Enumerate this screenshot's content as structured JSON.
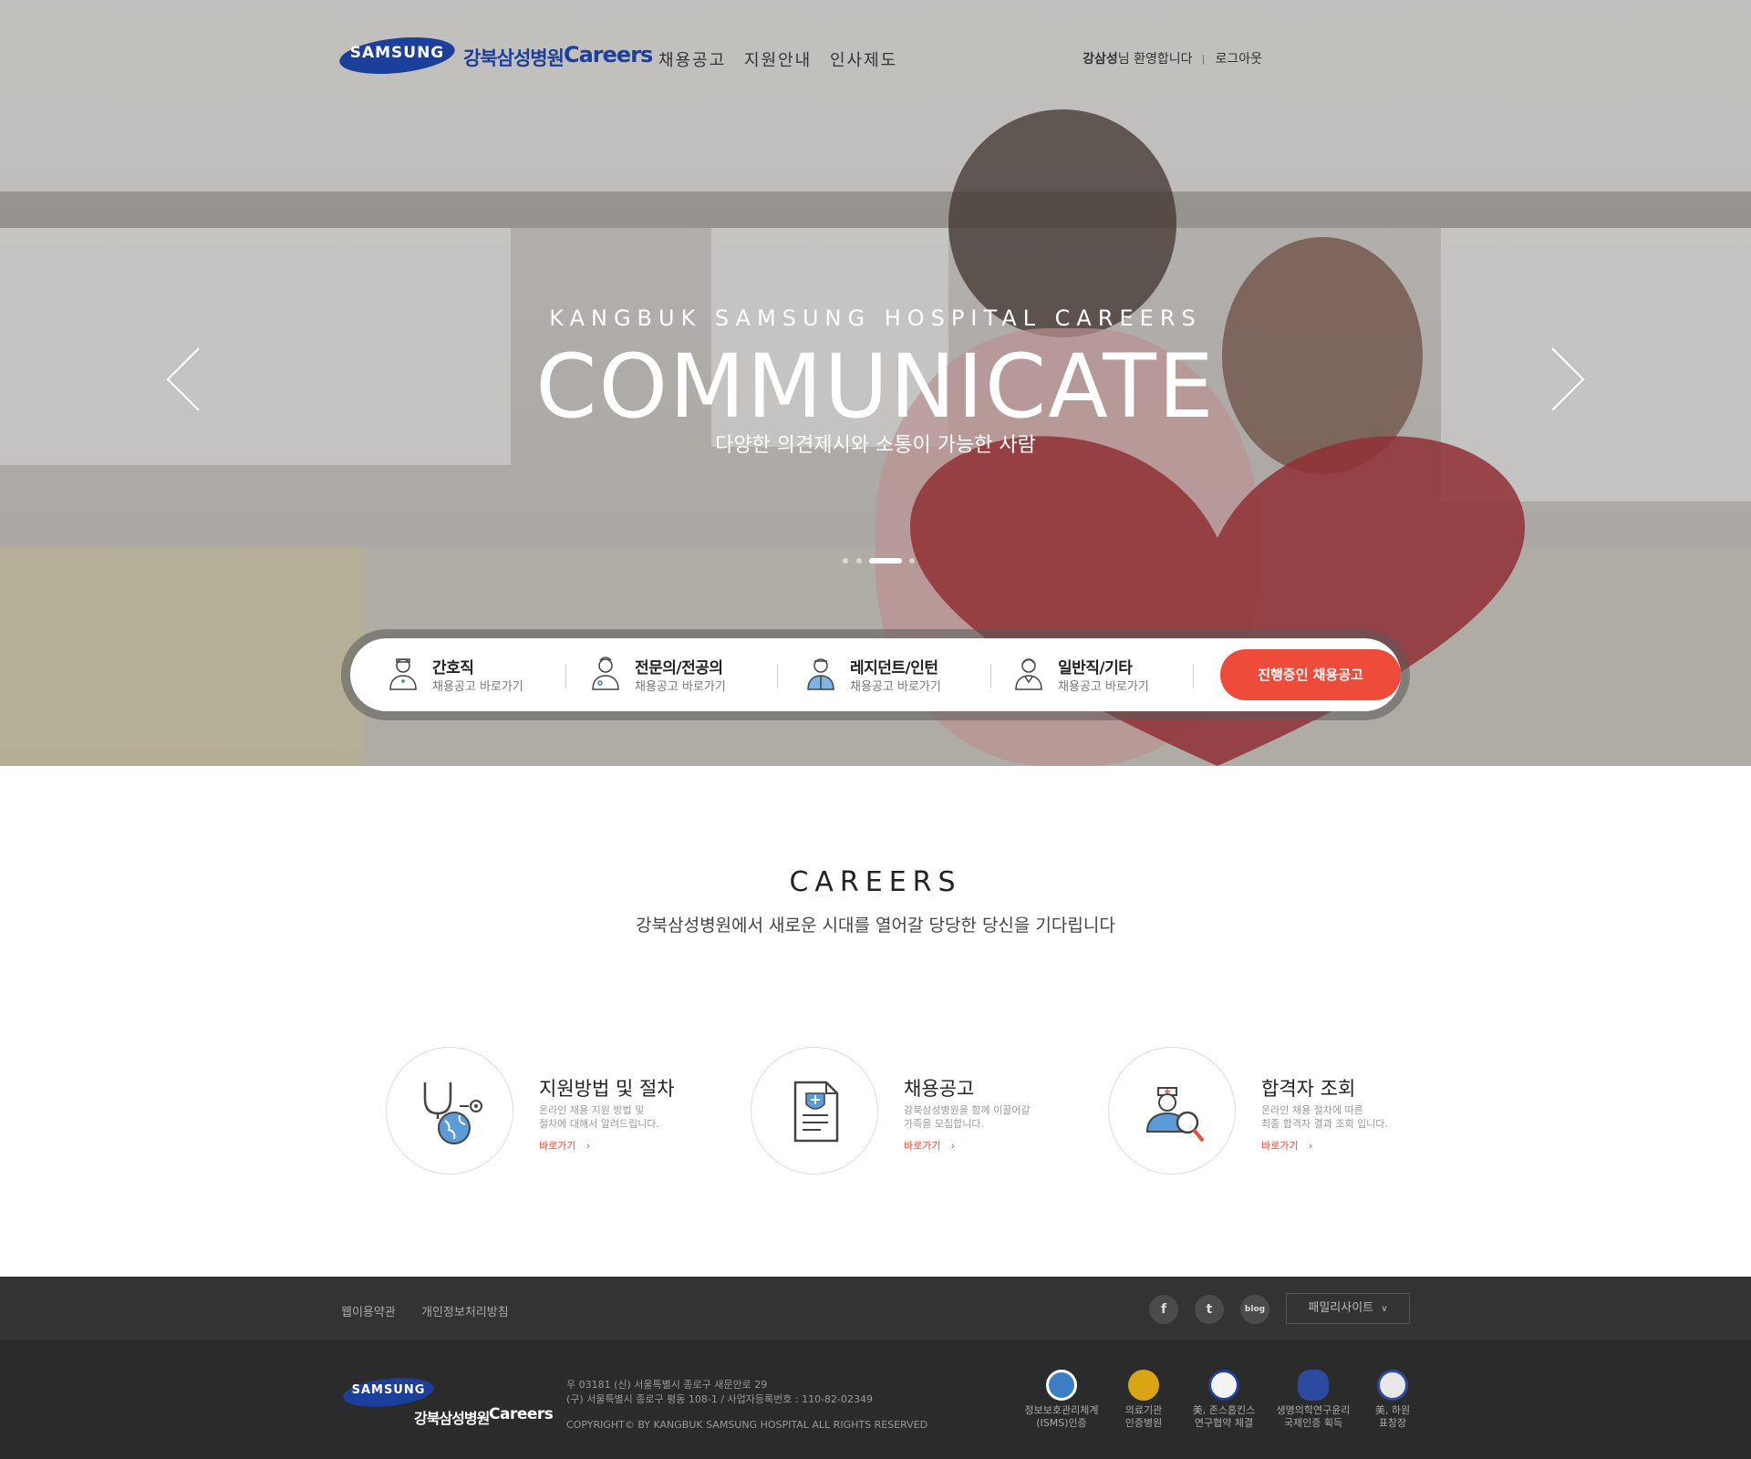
{
  "header": {
    "logo_text": "SAMSUNG",
    "brand_kr": "강북삼성병원",
    "brand_en": "Careers",
    "nav": [
      "채용공고",
      "지원안내",
      "인사제도"
    ],
    "user_name": "강삼성",
    "welcome_suffix": "님 환영합니다",
    "logout": "로그아웃"
  },
  "hero": {
    "subtitle": "KANGBUK SAMSUNG HOSPITAL CAREERS",
    "title": "COMMUNICATE",
    "description": "다양한 의견제시와 소통이 가능한 사람",
    "slides": 4,
    "active_slide": 3
  },
  "quickbar": {
    "items": [
      {
        "title": "간호직",
        "sub": "채용공고 바로가기",
        "icon": "nurse-icon"
      },
      {
        "title": "전문의/전공의",
        "sub": "채용공고 바로가기",
        "icon": "doctor-icon"
      },
      {
        "title": "레지던트/인턴",
        "sub": "채용공고 바로가기",
        "icon": "resident-icon"
      },
      {
        "title": "일반직/기타",
        "sub": "채용공고 바로가기",
        "icon": "staff-icon"
      }
    ],
    "cta": "진행중인 채용공고"
  },
  "careers": {
    "title": "CAREERS",
    "subtitle": "강북삼성병원에서 새로운 시대를 열어갈 당당한 당신을 기다립니다",
    "cards": [
      {
        "title": "지원방법 및 절차",
        "desc1": "온라인 채용 지원 방법 및",
        "desc2": "절차에 대해서 알려드립니다.",
        "link": "바로가기",
        "icon": "stethoscope-globe-icon"
      },
      {
        "title": "채용공고",
        "desc1": "강북삼성병원을 함께 이끌어갈",
        "desc2": "가족을 모집합니다.",
        "link": "바로가기",
        "icon": "medical-document-icon"
      },
      {
        "title": "합격자 조회",
        "desc1": "온라인 채용 절차에 따른",
        "desc2": "최종 합격자 결과 조회 입니다.",
        "link": "바로가기",
        "icon": "doctor-search-icon"
      }
    ]
  },
  "footer": {
    "links": [
      "웹이용약관",
      "개인정보처리방침"
    ],
    "social": [
      {
        "name": "facebook-icon",
        "glyph": "f"
      },
      {
        "name": "twitter-icon",
        "glyph": "t"
      },
      {
        "name": "blog-icon",
        "glyph": "blog"
      }
    ],
    "family_site": "패밀리사이트",
    "logo_text": "SAMSUNG",
    "brand_kr": "강북삼성병원",
    "brand_en": "Careers",
    "address1": "우 03181 (신) 서울특별시 종로구 새문안로 29",
    "address2": "(구) 서울특별시 종로구 평동 108-1  /  사업자등록번호 : 110-82-02349",
    "copyright": "COPYRIGHT© BY KANGBUK SAMSUNG HOSPITAL ALL RIGHTS RESERVED",
    "certs": [
      {
        "line1": "정보보호관리체계",
        "line2": "(ISMS)인증",
        "color": "#3d7fc4"
      },
      {
        "line1": "의료기관",
        "line2": "인증병원",
        "color": "#d9a514"
      },
      {
        "line1": "美, 존스홉킨스",
        "line2": "연구협약 체결",
        "color": "#f3f3f3"
      },
      {
        "line1": "생명의학연구윤리",
        "line2": "국제인증 획득",
        "color": "#2c4aa0"
      },
      {
        "line1": "美, 하원",
        "line2": "표창장",
        "color": "#e8e8e8"
      }
    ]
  },
  "colors": {
    "brand_blue": "#1c3f9c",
    "accent_red": "#ef4b3b",
    "footer_dark": "#2b2b2b"
  }
}
